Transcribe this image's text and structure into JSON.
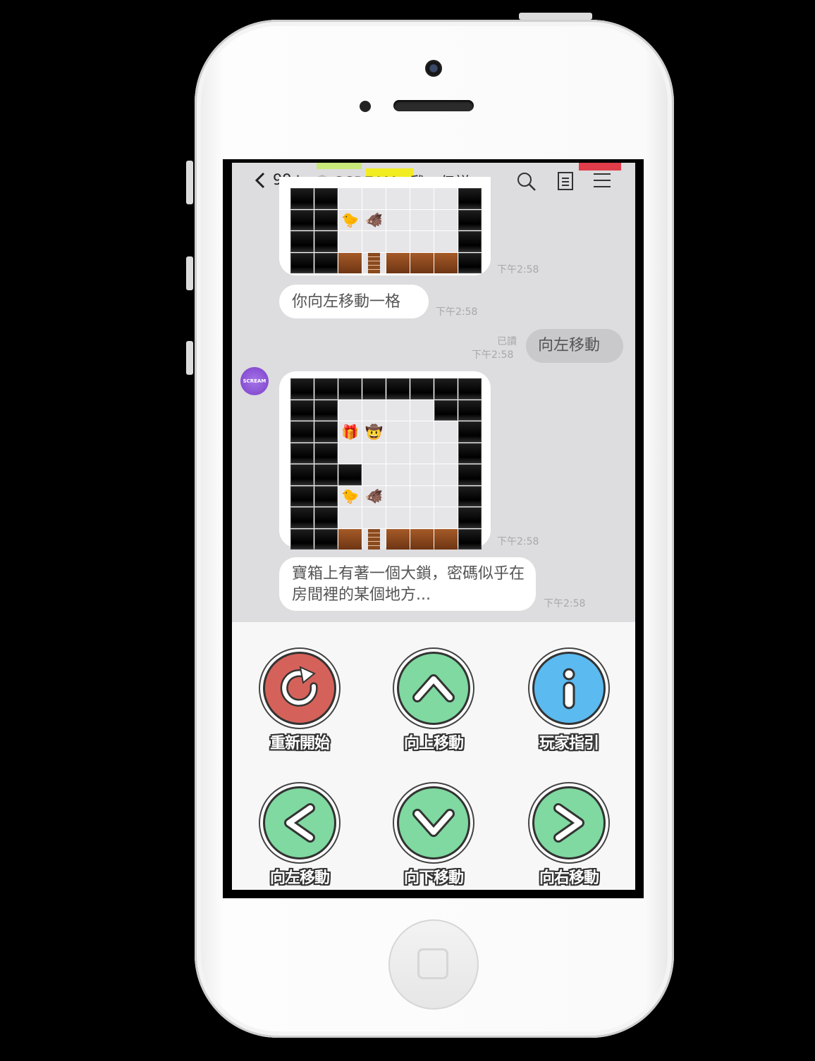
{
  "header": {
    "back_count": "99+",
    "title": "SCREAM...雞の伝説"
  },
  "messages": {
    "top_image_time": "下午2:58",
    "msg1_text": "你向左移動一格",
    "msg1_time": "下午2:58",
    "sent_read": "已讀",
    "sent_time": "下午2:58",
    "sent_text": "向左移動",
    "avatar_text": "SCREAM",
    "image2_time": "下午2:58",
    "msg2_text": "寶箱上有著一個大鎖，密碼似乎在房間裡的某個地方...",
    "msg2_time": "下午2:58"
  },
  "controls": {
    "restart": "重新開始",
    "up": "向上移動",
    "guide": "玩家指引",
    "left": "向左移動",
    "down": "向下移動",
    "right": "向右移動"
  },
  "colors": {
    "restart": "#d5625a",
    "move": "#7fd9a0",
    "info": "#5bbaf0",
    "chat_bg": "#dddcde"
  },
  "map_top": [
    "WWFFFFFW",
    "WWCBFFFW",
    "WWFFFFFW",
    "WWRDRRRW"
  ],
  "map_full": [
    "WWWWWWWW",
    "WWFFFFWW",
    "WWGHFFFW",
    "WWFFFFFW",
    "WWWFFFFW",
    "WWCBFFFW",
    "WWFFFFFW",
    "WWRDRRRW"
  ],
  "glyphs": {
    "C": "🐤",
    "B": "🐗",
    "G": "🎁",
    "H": "🤠"
  }
}
